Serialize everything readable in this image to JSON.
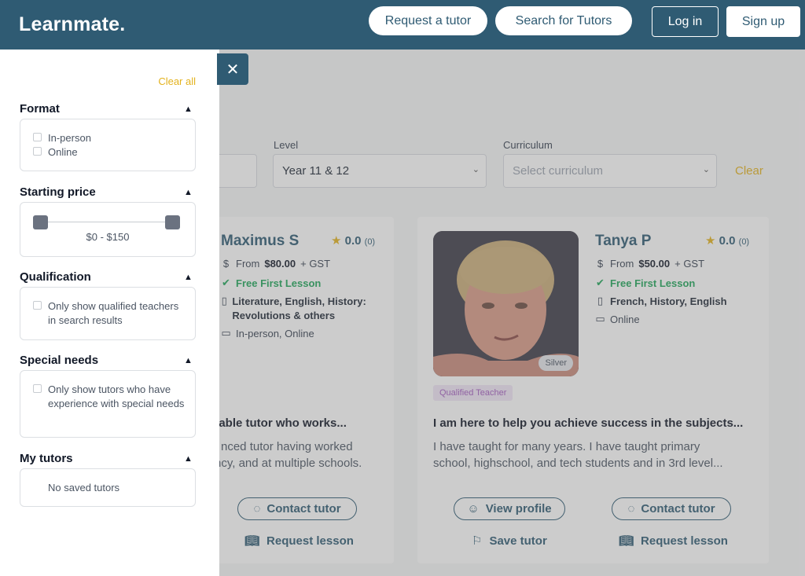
{
  "header": {
    "logo": "Learnmate.",
    "request_tutor": "Request a tutor",
    "search_tutors": "Search for Tutors",
    "login": "Log in",
    "signup": "Sign up"
  },
  "filters_bar": {
    "level_label": "Level",
    "level_value": "Year 11 & 12",
    "curriculum_label": "Curriculum",
    "curriculum_placeholder": "Select curriculum",
    "clear": "Clear"
  },
  "sidebar": {
    "clear_all": "Clear all",
    "format": {
      "title": "Format",
      "options": [
        "In-person",
        "Online"
      ]
    },
    "starting_price": {
      "title": "Starting price",
      "range": "$0 - $150",
      "min": 0,
      "max": 150
    },
    "qualification": {
      "title": "Qualification",
      "option": "Only show qualified teachers in search results"
    },
    "special_needs": {
      "title": "Special needs",
      "option": "Only show tutors who have experience with special needs"
    },
    "my_tutors": {
      "title": "My tutors",
      "empty": "No saved tutors"
    }
  },
  "tutors": [
    {
      "name": "Maximus S",
      "rating": "0.0",
      "reviews": "(0)",
      "price_prefix": "From",
      "price": "$80.00",
      "price_suffix": "+ GST",
      "free_lesson": "Free First Lesson",
      "subjects": "Literature, English, History: Revolutions & others",
      "modes": "In-person, Online",
      "headline": "eable tutor who works...",
      "description": "nced tutor having worked ncy, and at multiple schools.",
      "desc_line1": "nced tutor having worked",
      "desc_line2": "ncy, and at multiple schools.",
      "contact": "Contact tutor",
      "request": "Request lesson"
    },
    {
      "name": "Tanya P",
      "rating": "0.0",
      "reviews": "(0)",
      "price_prefix": "From",
      "price": "$50.00",
      "price_suffix": "+ GST",
      "free_lesson": "Free First Lesson",
      "subjects": "French, History, English",
      "modes": "Online",
      "badge": "Silver",
      "qualified": "Qualified Teacher",
      "headline": "I am here to help you achieve success in the subjects...",
      "desc_line1": "I have taught for many years. I have taught primary",
      "desc_line2": "school, highschool, and tech students and in 3rd level...",
      "view_profile": "View profile",
      "contact": "Contact tutor",
      "save": "Save tutor",
      "request": "Request lesson"
    }
  ],
  "colors": {
    "brand": "#2f5b73",
    "accent": "#e3b21d",
    "green": "#1fa65a"
  }
}
